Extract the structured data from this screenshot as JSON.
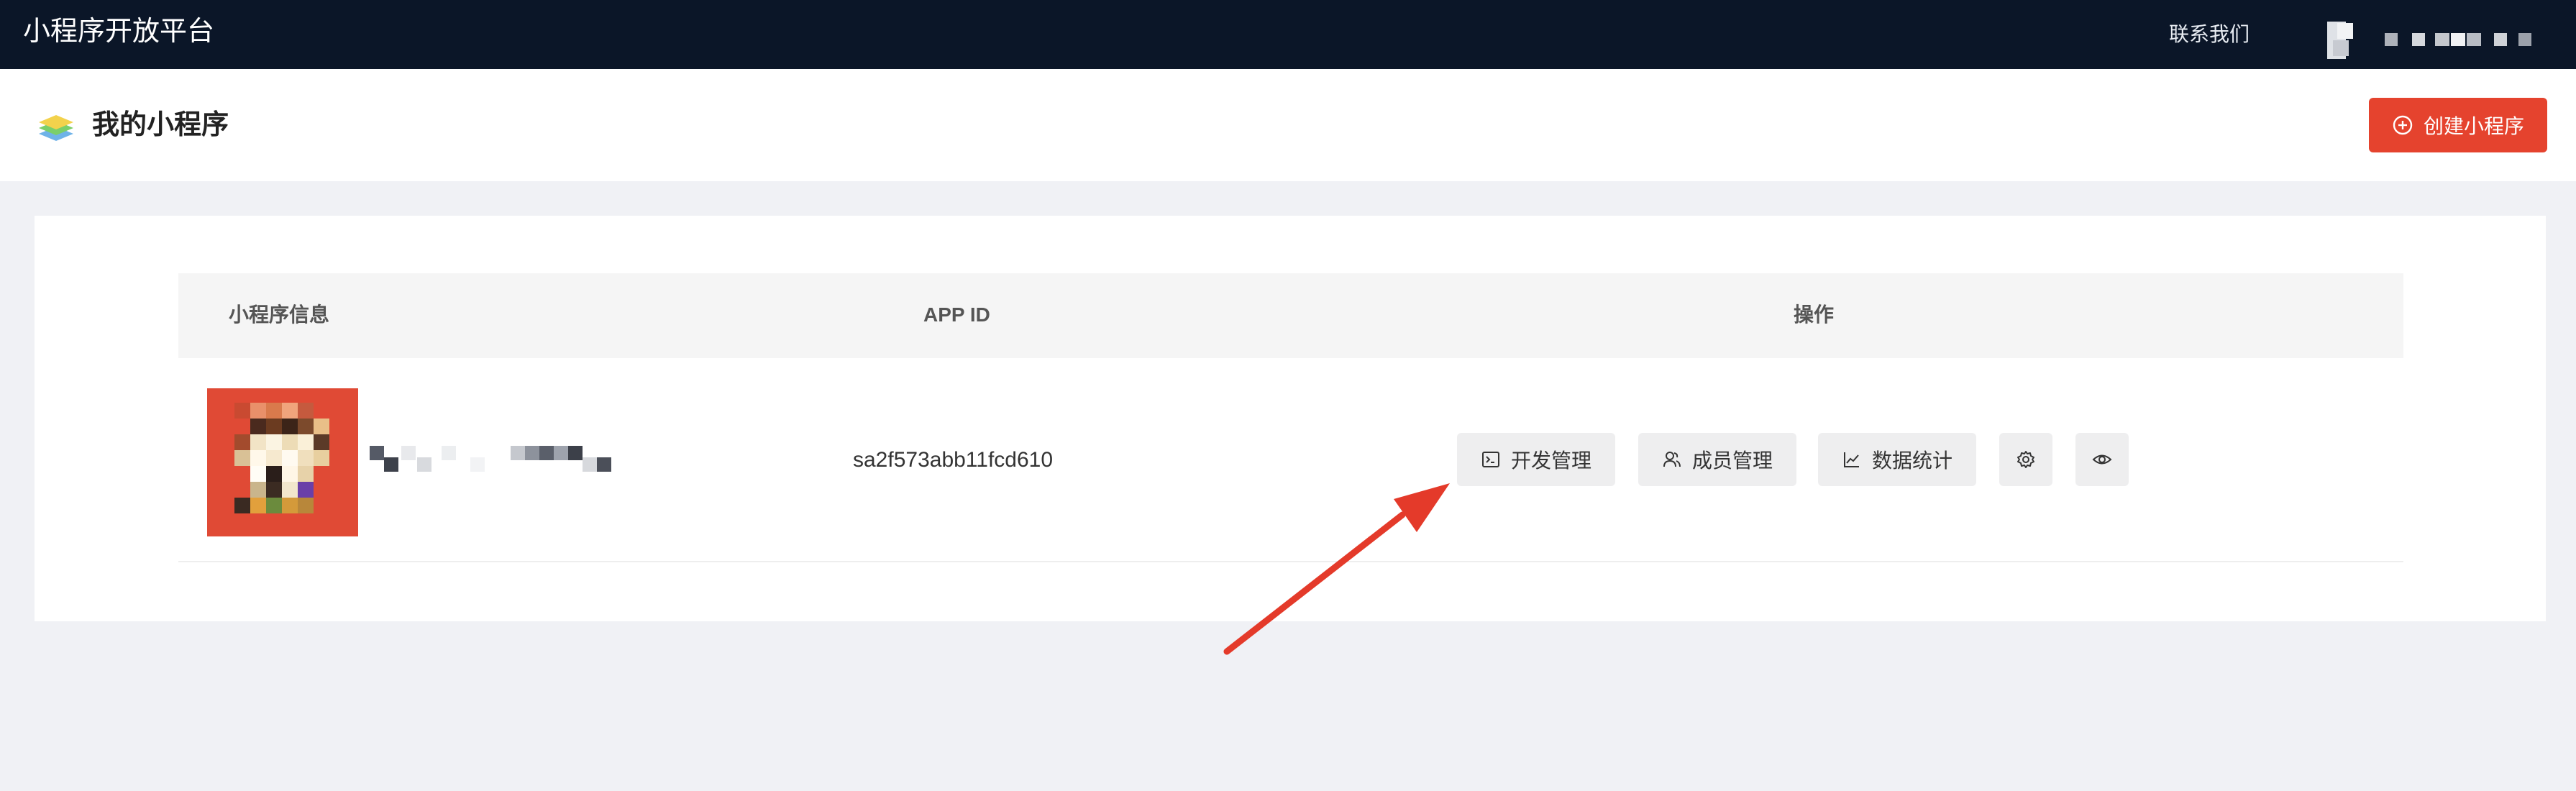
{
  "header": {
    "brand": "小程序开放平台",
    "contact_label": "联系我们",
    "user_name_pixelated": "user-avatar-and-name"
  },
  "page": {
    "title": "我的小程序",
    "create_button": "创建小程序",
    "layers_icon": "layers-icon"
  },
  "table": {
    "columns": [
      "小程序信息",
      "APP ID",
      "操作"
    ],
    "rows": [
      {
        "app_icon": "app-icon-pixelated",
        "app_name": "pixelated-app-name",
        "app_id": "sa2f573abb11fcd610",
        "actions": {
          "dev_manage": "开发管理",
          "member_manage": "成员管理",
          "data_stats": "数据统计",
          "settings_icon": "gear-icon",
          "preview_icon": "eye-icon"
        }
      }
    ]
  },
  "colors": {
    "topbar": "#0b1628",
    "accent": "#e5432e",
    "page_bg": "#f0f1f5",
    "table_header_bg": "#f5f5f5",
    "action_button_bg": "#eeeeef"
  },
  "annotation": {
    "arrow_color": "#e43a2a",
    "arrow_points_to": "开发管理"
  }
}
